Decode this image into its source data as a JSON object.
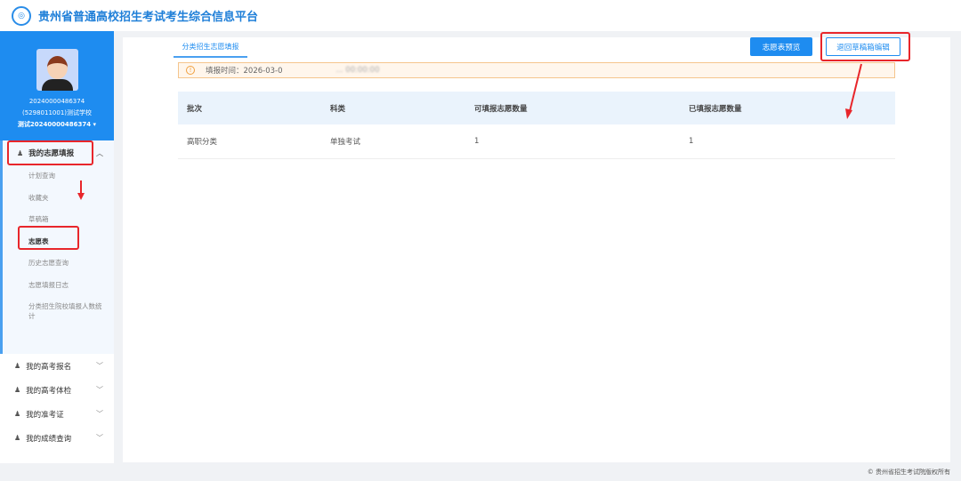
{
  "header": {
    "title": "贵州省普通高校招生考试考生综合信息平台"
  },
  "profile": {
    "id": "20240000486374",
    "school": "(5298011001)测试学校",
    "name": "测试20240000486374"
  },
  "sidebar": {
    "active_group": "我的志愿填报",
    "sub_items": [
      "计划查询",
      "收藏夹",
      "草稿箱",
      "志愿表",
      "历史志愿查询",
      "志愿填报日志",
      "分类招生院校填报人数统计"
    ],
    "active_sub": "志愿表",
    "groups": [
      "我的高考报名",
      "我的高考体检",
      "我的准考证",
      "我的成绩查询"
    ]
  },
  "main": {
    "tab": "分类招生志愿填报",
    "preview_button": "志愿表预览",
    "return_button": "退回草稿箱编辑",
    "notice": "填报时间：2026-03-0",
    "notice_tail": "... 00:00:00",
    "table": {
      "headers": [
        "批次",
        "科类",
        "可填报志愿数量",
        "已填报志愿数量"
      ],
      "rows": [
        [
          "高职分类",
          "单独考试",
          "1",
          "1"
        ]
      ]
    }
  },
  "footer": "© 贵州省招生考试院版权所有",
  "colors": {
    "brand": "#1e8cf0",
    "annotation": "#e8262b"
  }
}
